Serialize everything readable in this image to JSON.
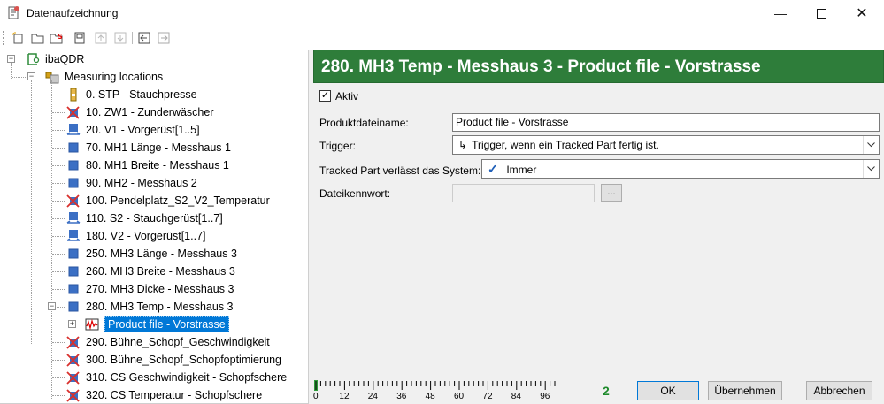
{
  "window": {
    "title": "Datenaufzeichnung"
  },
  "toolbar": {
    "icons": [
      "new-icon",
      "open-folder-icon",
      "open-s-icon",
      "save-icon",
      "move-up-icon",
      "move-down-icon",
      "back-icon",
      "forward-icon"
    ]
  },
  "tree": {
    "root": "ibaQDR",
    "group": "Measuring locations",
    "items": [
      {
        "label": "0. STP - Stauchpresse",
        "icon": "gauge"
      },
      {
        "label": "10. ZW1 - Zunderwäscher",
        "icon": "cross"
      },
      {
        "label": "20. V1 - Vorgerüst[1..5]",
        "icon": "arrows"
      },
      {
        "label": "70. MH1 Länge - Messhaus 1",
        "icon": "block"
      },
      {
        "label": "80. MH1 Breite - Messhaus 1",
        "icon": "block"
      },
      {
        "label": "90. MH2 - Messhaus 2",
        "icon": "block"
      },
      {
        "label": "100. Pendelplatz_S2_V2_Temperatur",
        "icon": "cross"
      },
      {
        "label": "110. S2 - Stauchgerüst[1..7]",
        "icon": "arrows"
      },
      {
        "label": "180. V2 - Vorgerüst[1..7]",
        "icon": "arrows"
      },
      {
        "label": "250. MH3 Länge - Messhaus 3",
        "icon": "block"
      },
      {
        "label": "260. MH3 Breite - Messhaus 3",
        "icon": "block"
      },
      {
        "label": "270. MH3 Dicke - Messhaus 3",
        "icon": "block"
      },
      {
        "label": "280. MH3 Temp - Messhaus 3",
        "icon": "block"
      }
    ],
    "child": "Product file - Vorstrasse",
    "items_after": [
      {
        "label": "290. Bühne_Schopf_Geschwindigkeit",
        "icon": "cross"
      },
      {
        "label": "300. Bühne_Schopf_Schopfoptimierung",
        "icon": "cross"
      },
      {
        "label": "310. CS Geschwindigkeit - Schopfschere",
        "icon": "cross"
      },
      {
        "label": "320. CS Temperatur - Schopfschere",
        "icon": "cross"
      }
    ]
  },
  "panel": {
    "header": "280. MH3 Temp - Messhaus 3 - Product file - Vorstrasse",
    "aktiv_label": "Aktiv",
    "aktiv_checked": true,
    "product_name_label": "Produktdateiname:",
    "product_name_value": "Product file - Vorstrasse",
    "trigger_label": "Trigger:",
    "trigger_value": "Trigger, wenn ein Tracked Part fertig ist.",
    "tracked_label": "Tracked Part verlässt das System:",
    "tracked_value": "Immer",
    "password_label": "Dateikennwort:",
    "password_value": "",
    "browse_label": "..."
  },
  "footer": {
    "ruler_ticks": [
      "0",
      "12",
      "24",
      "36",
      "48",
      "60",
      "72",
      "84",
      "96"
    ],
    "count": "2",
    "ok_label": "OK",
    "apply_label": "Übernehmen",
    "cancel_label": "Abbrechen"
  },
  "colors": {
    "header_bg": "#2e7d3a",
    "selection": "#0078d7",
    "count": "#1e8a2b"
  }
}
